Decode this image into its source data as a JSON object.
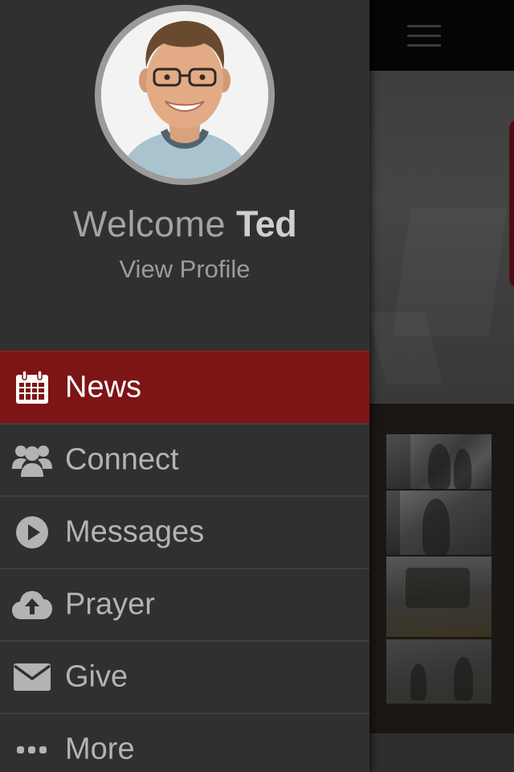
{
  "profile": {
    "welcome_text": "Welcome",
    "user_name": "Ted",
    "view_profile_label": "View Profile"
  },
  "menu": {
    "items": [
      {
        "label": "News",
        "icon": "calendar-icon",
        "active": true
      },
      {
        "label": "Connect",
        "icon": "users-icon",
        "active": false
      },
      {
        "label": "Messages",
        "icon": "play-circle-icon",
        "active": false
      },
      {
        "label": "Prayer",
        "icon": "cloud-upload-icon",
        "active": false
      },
      {
        "label": "Give",
        "icon": "envelope-icon",
        "active": false
      },
      {
        "label": "More",
        "icon": "ellipsis-icon",
        "active": false
      }
    ]
  },
  "colors": {
    "drawer_bg": "#303030",
    "active_item_bg": "#7d1416",
    "text_muted": "#b3b3b3",
    "text_active": "#ffffff",
    "avatar_ring": "#9b9b9b"
  },
  "background_app": {
    "menu_icon": "hamburger-icon"
  }
}
